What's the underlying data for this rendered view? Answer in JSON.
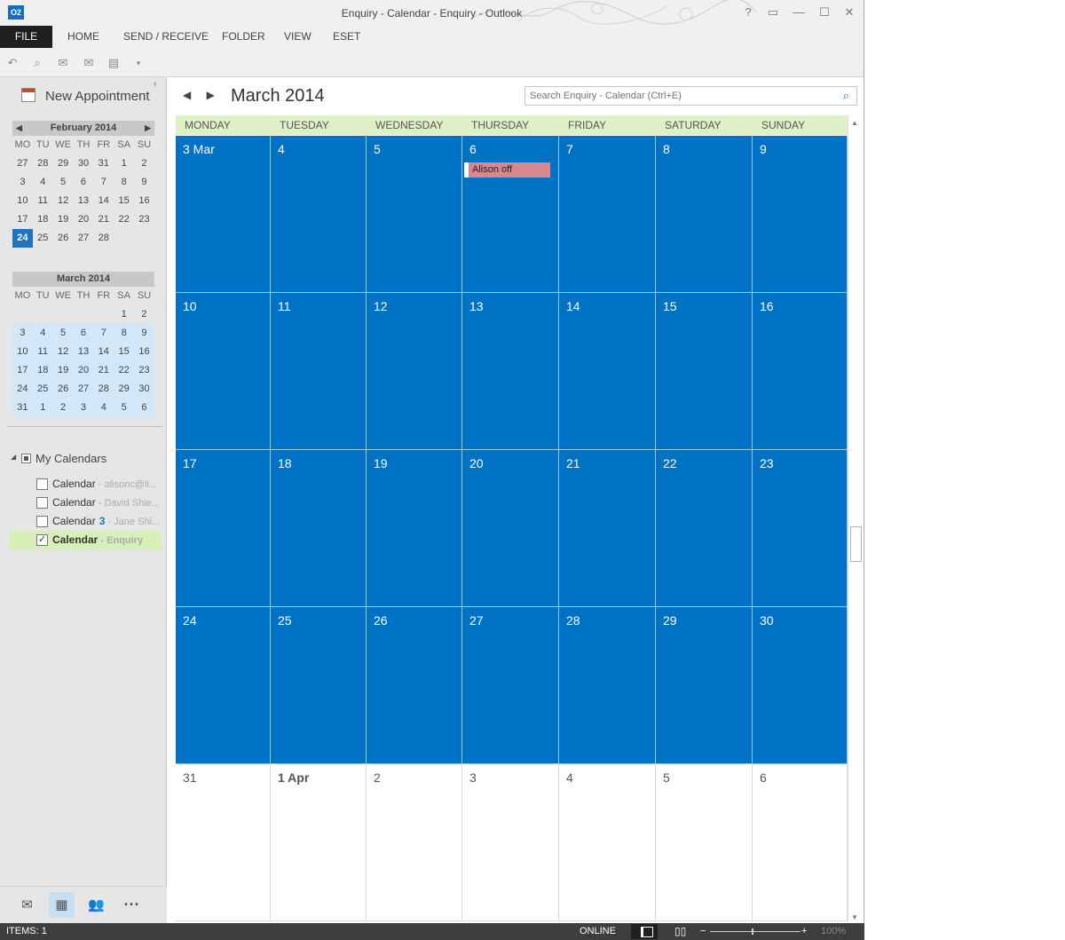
{
  "window": {
    "title": "Enquiry - Calendar - Enquiry - Outlook",
    "logo": "O2",
    "help": "?",
    "restore": "▭",
    "minimize": "—",
    "maximize": "☐",
    "close": "✕"
  },
  "ribbon": {
    "tabs": [
      "FILE",
      "HOME",
      "SEND / RECEIVE",
      "FOLDER",
      "VIEW",
      "ESET"
    ]
  },
  "qat": {
    "icons": [
      "undo-icon",
      "print-preview-icon",
      "reply-icon",
      "reply-all-icon",
      "print-icon",
      "customize-icon"
    ]
  },
  "nav": {
    "new_appointment": "New Appointment",
    "collapse": "‹",
    "mini_cals": [
      {
        "month": "February 2014",
        "dow": [
          "MO",
          "TU",
          "WE",
          "TH",
          "FR",
          "SA",
          "SU"
        ],
        "weeks": [
          [
            "27",
            "28",
            "29",
            "30",
            "31",
            "1",
            "2"
          ],
          [
            "3",
            "4",
            "5",
            "6",
            "7",
            "8",
            "9"
          ],
          [
            "10",
            "11",
            "12",
            "13",
            "14",
            "15",
            "16"
          ],
          [
            "17",
            "18",
            "19",
            "20",
            "21",
            "22",
            "23"
          ],
          [
            "24",
            "25",
            "26",
            "27",
            "28",
            "",
            ""
          ]
        ],
        "today_index": [
          4,
          0
        ]
      },
      {
        "month": "March 2014",
        "dow": [
          "MO",
          "TU",
          "WE",
          "TH",
          "FR",
          "SA",
          "SU"
        ],
        "weeks": [
          [
            "",
            "",
            "",
            "",
            "",
            "1",
            "2"
          ],
          [
            "3",
            "4",
            "5",
            "6",
            "7",
            "8",
            "9"
          ],
          [
            "10",
            "11",
            "12",
            "13",
            "14",
            "15",
            "16"
          ],
          [
            "17",
            "18",
            "19",
            "20",
            "21",
            "22",
            "23"
          ],
          [
            "24",
            "25",
            "26",
            "27",
            "28",
            "29",
            "30"
          ],
          [
            "31",
            "1",
            "2",
            "3",
            "4",
            "5",
            "6"
          ]
        ],
        "selected_weeks": [
          1,
          2,
          3,
          4,
          5
        ]
      }
    ],
    "my_calendars": {
      "label": "My Calendars",
      "items": [
        {
          "name": "Calendar",
          "sub": " - alisonc@li...",
          "count": "",
          "checked": false,
          "active": false
        },
        {
          "name": "Calendar",
          "sub": " - David Shie...",
          "count": "",
          "checked": false,
          "active": false
        },
        {
          "name": "Calendar",
          "sub": " - Jane Shi...",
          "count": "3",
          "checked": false,
          "active": false
        },
        {
          "name": "Calendar",
          "sub": " - Enquiry",
          "count": "",
          "checked": true,
          "active": true
        }
      ]
    },
    "bottom_icons": [
      "mail-icon",
      "calendar-icon",
      "people-icon",
      "more-icon"
    ]
  },
  "main": {
    "month_title": "March 2014",
    "search_placeholder": "Search Enquiry - Calendar (Ctrl+E)",
    "dow": [
      "MONDAY",
      "TUESDAY",
      "WEDNESDAY",
      "THURSDAY",
      "FRIDAY",
      "SATURDAY",
      "SUNDAY"
    ],
    "weeks": [
      [
        {
          "d": "3 Mar"
        },
        {
          "d": "4"
        },
        {
          "d": "5"
        },
        {
          "d": "6",
          "event": "Alison off"
        },
        {
          "d": "7"
        },
        {
          "d": "8"
        },
        {
          "d": "9"
        }
      ],
      [
        {
          "d": "10"
        },
        {
          "d": "11"
        },
        {
          "d": "12"
        },
        {
          "d": "13"
        },
        {
          "d": "14"
        },
        {
          "d": "15"
        },
        {
          "d": "16"
        }
      ],
      [
        {
          "d": "17"
        },
        {
          "d": "18"
        },
        {
          "d": "19"
        },
        {
          "d": "20"
        },
        {
          "d": "21"
        },
        {
          "d": "22"
        },
        {
          "d": "23"
        }
      ],
      [
        {
          "d": "24"
        },
        {
          "d": "25"
        },
        {
          "d": "26"
        },
        {
          "d": "27"
        },
        {
          "d": "28"
        },
        {
          "d": "29"
        },
        {
          "d": "30"
        }
      ],
      [
        {
          "d": "31",
          "out": true
        },
        {
          "d": "1 Apr",
          "out": true,
          "bold": true
        },
        {
          "d": "2",
          "out": true
        },
        {
          "d": "3",
          "out": true
        },
        {
          "d": "4",
          "out": true
        },
        {
          "d": "5",
          "out": true
        },
        {
          "d": "6",
          "out": true
        }
      ]
    ]
  },
  "status": {
    "items": "ITEMS: 1",
    "online": "ONLINE",
    "zoom": "100%",
    "zoom_minus": "−",
    "zoom_plus": "+"
  },
  "colors": {
    "accent": "#0072c6",
    "event": "#d9878f",
    "dow_header": "#dff0c7"
  }
}
